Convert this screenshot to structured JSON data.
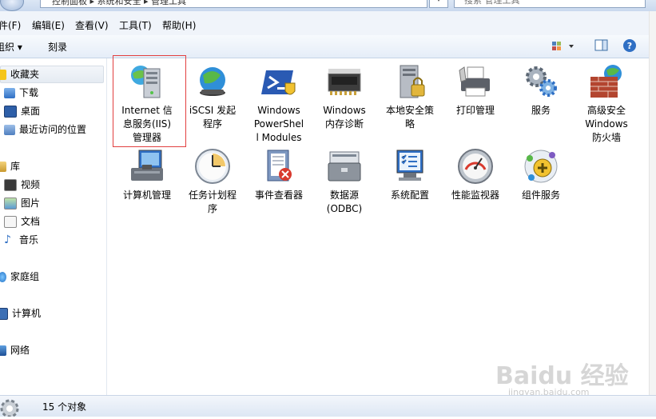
{
  "address": {
    "path": "控制面板 ▸ 系统和安全 ▸ 管理工具",
    "search_placeholder": "搜索 管理工具"
  },
  "menu": [
    "件(F)",
    "编辑(E)",
    "查看(V)",
    "工具(T)",
    "帮助(H)"
  ],
  "toolbar": {
    "organize": "组织 ▾",
    "burn": "刻录"
  },
  "nav": {
    "favorites": "收藏夹",
    "downloads": "下载",
    "desktop": "桌面",
    "recent": "最近访问的位置",
    "libraries": "库",
    "videos": "视频",
    "pictures": "图片",
    "documents": "文档",
    "music": "音乐",
    "homegroup": "家庭组",
    "computer": "计算机",
    "network": "网络"
  },
  "items": [
    {
      "id": "iis",
      "lines": [
        "Internet 信",
        "息服务(IIS)",
        "管理器"
      ]
    },
    {
      "id": "iscsi",
      "lines": [
        "iSCSI 发起",
        "程序"
      ]
    },
    {
      "id": "powershell",
      "lines": [
        "Windows",
        "PowerShel",
        "l Modules"
      ]
    },
    {
      "id": "memdiag",
      "lines": [
        "Windows",
        "内存诊断"
      ]
    },
    {
      "id": "secpol",
      "lines": [
        "本地安全策",
        "略"
      ]
    },
    {
      "id": "printmgmt",
      "lines": [
        "打印管理"
      ]
    },
    {
      "id": "services",
      "lines": [
        "服务"
      ]
    },
    {
      "id": "firewall",
      "lines": [
        "高级安全",
        "Windows",
        "防火墙"
      ]
    },
    {
      "id": "compmgmt",
      "lines": [
        "计算机管理"
      ]
    },
    {
      "id": "tasksched",
      "lines": [
        "任务计划程",
        "序"
      ]
    },
    {
      "id": "eventvwr",
      "lines": [
        "事件查看器"
      ]
    },
    {
      "id": "odbc",
      "lines": [
        "数据源",
        "(ODBC)"
      ]
    },
    {
      "id": "msconfig",
      "lines": [
        "系统配置"
      ]
    },
    {
      "id": "perfmon",
      "lines": [
        "性能监视器"
      ]
    },
    {
      "id": "compsvc",
      "lines": [
        "组件服务"
      ]
    }
  ],
  "status": {
    "count": "15 个对象"
  },
  "watermark": {
    "main": "Baidu 经验",
    "sub": "jingyan.baidu.com"
  },
  "colors": {
    "accent": "#3b73c6",
    "highlight_border": "#e24040"
  }
}
